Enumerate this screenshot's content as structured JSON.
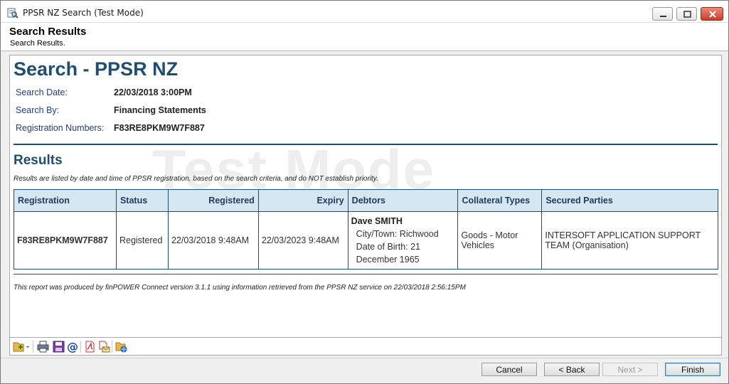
{
  "window": {
    "title": "PPSR NZ Search (Test Mode)"
  },
  "header": {
    "title": "Search Results",
    "subtitle": "Search Results."
  },
  "report": {
    "title": "Search - PPSR NZ",
    "watermark": "Test Mode",
    "info": [
      {
        "label": "Search Date:",
        "value": "22/03/2018 3:00PM"
      },
      {
        "label": "Search By:",
        "value": "Financing Statements"
      },
      {
        "label": "Registration Numbers:",
        "value": "F83RE8PKM9W7F887"
      }
    ],
    "results_heading": "Results",
    "results_note": "Results are listed by date and time of PPSR registration, based on the search criteria, and do NOT establish priority.",
    "table": {
      "headers": [
        "Registration",
        "Status",
        "Registered",
        "Expiry",
        "Debtors",
        "Collateral Types",
        "Secured Parties"
      ],
      "rows": [
        {
          "registration": "F83RE8PKM9W7F887",
          "status": "Registered",
          "registered": "22/03/2018 9:48AM",
          "expiry": "22/03/2023 9:48AM",
          "debtor_name": "Dave SMITH",
          "debtor_city": "City/Town: Richwood",
          "debtor_dob": "Date of Birth: 21 December 1965",
          "collateral": "Goods - Motor Vehicles",
          "secured_parties": "INTERSOFT APPLICATION SUPPORT TEAM (Organisation)"
        }
      ]
    },
    "footer_note": "This report was produced by finPOWER Connect version 3.1.1 using information retrieved from the PPSR NZ service on 22/03/2018 2:56:15PM"
  },
  "toolbar": {
    "icons": [
      "new-document-icon",
      "print-icon",
      "save-icon",
      "email-icon",
      "pdf-icon",
      "pdf-email-icon",
      "web-export-icon"
    ]
  },
  "buttons": {
    "cancel": "Cancel",
    "back": "< Back",
    "next": "Next >",
    "finish": "Finish"
  },
  "colors": {
    "accent": "#1f4e6e",
    "header_bg": "#d4e7f2",
    "link": "#1f4fa5"
  }
}
